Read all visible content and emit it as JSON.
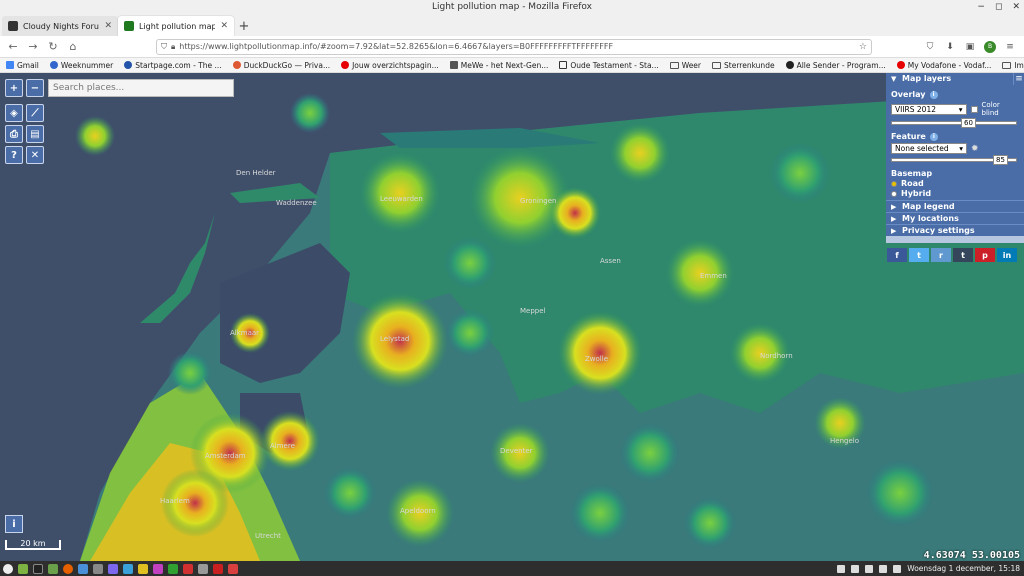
{
  "window": {
    "title": "Light pollution map - Mozilla Firefox"
  },
  "tabs": [
    {
      "label": "Cloudy Nights Forums",
      "active": false,
      "favicon_color": "#333333"
    },
    {
      "label": "Light pollution map",
      "active": true,
      "favicon_color": "#1f7a1f"
    }
  ],
  "nav": {
    "url": "https://www.lightpollutionmap.info/#zoom=7.92&lat=52.8265&lon=6.4667&layers=B0FFFFFFFFFTFFFFFFFF"
  },
  "bookmarks": [
    {
      "label": "Gmail",
      "icon": "google-icon",
      "color": "#4285f4"
    },
    {
      "label": "Weeknummer",
      "icon": "globe-icon",
      "color": "#3366cc"
    },
    {
      "label": "Startpage.com - The ...",
      "icon": "search-icon",
      "color": "#2255aa"
    },
    {
      "label": "DuckDuckGo — Priva...",
      "icon": "duck-icon",
      "color": "#de5833"
    },
    {
      "label": "Jouw overzichtspagin...",
      "icon": "vodafone-icon",
      "color": "#e60000"
    },
    {
      "label": "MeWe - het Next-Gen...",
      "icon": "mewe-icon",
      "color": "#555555"
    },
    {
      "label": "Oude Testament - Sta...",
      "icon": "page-icon",
      "color": "#333333"
    },
    {
      "label": "Weer",
      "icon": "folder-icon",
      "color": "#555555"
    },
    {
      "label": "Sterrenkunde",
      "icon": "folder-icon",
      "color": "#555555"
    },
    {
      "label": "Alle Sender - Program...",
      "icon": "tv-icon",
      "color": "#222222"
    },
    {
      "label": "My Vodafone - Vodaf...",
      "icon": "vodafone-icon",
      "color": "#e60000"
    },
    {
      "label": "Imported",
      "icon": "folder-icon",
      "color": "#555555"
    }
  ],
  "map": {
    "search_placeholder": "Search places...",
    "scale_label": "20 km",
    "coordinates": "4.63074 53.00105",
    "place_labels": [
      "Den Helder",
      "Waddenzee",
      "Groningen",
      "Leeuwarden",
      "Amsterdam",
      "Lelystad",
      "Zwolle",
      "Assen",
      "Emmen",
      "Haarlem",
      "Almere",
      "Alkmaar",
      "Apeldoorn",
      "Deventer",
      "Utrecht",
      "Hengelo",
      "Meppel",
      "Nordhorn"
    ],
    "controls": {
      "zoom_in": "+",
      "zoom_out": "−",
      "help": "?",
      "info": "i"
    }
  },
  "layers_panel": {
    "title": "Map layers",
    "overlay_label": "Overlay",
    "overlay_value": "VIIRS 2012",
    "color_blind_label": "Color blind",
    "overlay_opacity": "60",
    "feature_label": "Feature",
    "feature_value": "None selected",
    "feature_opacity": "85",
    "basemap_label": "Basemap",
    "basemap_options": [
      "Road",
      "Hybrid"
    ],
    "basemap_selected": "Road",
    "folds": [
      "Map legend",
      "My locations",
      "Privacy settings"
    ]
  },
  "share": [
    {
      "label": "f",
      "color": "#3b5998"
    },
    {
      "label": "t",
      "color": "#55acee"
    },
    {
      "label": "r",
      "color": "#5f99cf"
    },
    {
      "label": "t",
      "color": "#35465c"
    },
    {
      "label": "p",
      "color": "#cb2027"
    },
    {
      "label": "in",
      "color": "#007bb5"
    }
  ],
  "taskbar": {
    "clock": "Woensdag  1 december, 15:18"
  }
}
